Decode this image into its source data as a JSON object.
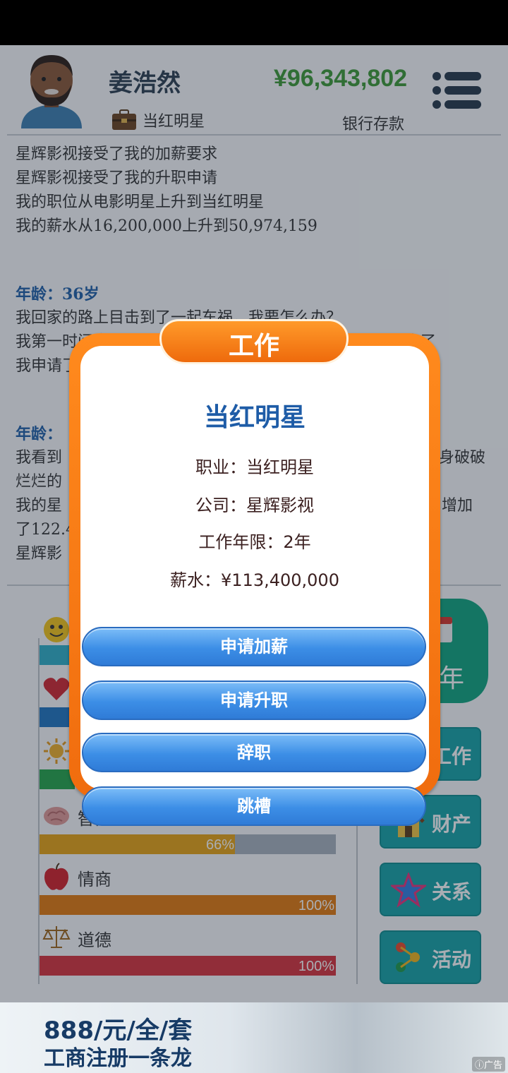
{
  "player": {
    "name": "姜浩然",
    "job": "当红明星"
  },
  "finance": {
    "money": "¥96,343,802",
    "money_label": "银行存款"
  },
  "log": {
    "entries": [
      "星辉影视接受了我的加薪要求",
      "星辉影视接受了我的升职申请",
      "我的职位从电影明星上升到当红明星",
      "我的薪水从16,200,000上升到50,974,159"
    ],
    "age1": "年龄：36岁",
    "age1_lines": [
      "我回家的路上目击到了一起车祸，我要怎么办？",
      "我第一时间拿",
      "我申请了"
    ],
    "age1_line2_tail": "逃走了",
    "age2": "年龄：",
    "age2_lines": [
      "我看到",
      "烂烂的",
      "我的星",
      "了122.4",
      "星辉影"
    ],
    "age2_line1_tail": "身破破",
    "age2_line3_tail": "增加"
  },
  "stats": [
    {
      "name": "智商",
      "value": "66%",
      "fraction": 0.66,
      "color": "#e8a412"
    },
    {
      "name": "情商",
      "value": "100%",
      "fraction": 1.0,
      "color": "#e47a0c"
    },
    {
      "name": "道德",
      "value": "100%",
      "fraction": 1.0,
      "color": "#d8313a"
    }
  ],
  "side_buttons": {
    "year": "年",
    "work": "工作",
    "property": "财产",
    "relations": "关系",
    "activity": "活动"
  },
  "dialog": {
    "tab": "工作",
    "title": "当红明星",
    "occupation": "职业：当红明星",
    "company": "公司：星辉影视",
    "years": "工作年限：2年",
    "salary": "薪水：¥113,400,000",
    "buttons": [
      "申请加薪",
      "申请升职",
      "辞职",
      "跳槽"
    ]
  },
  "ad": {
    "line1": "888/元/全/套",
    "line2": "工商注册一条龙",
    "tag": "广告"
  }
}
